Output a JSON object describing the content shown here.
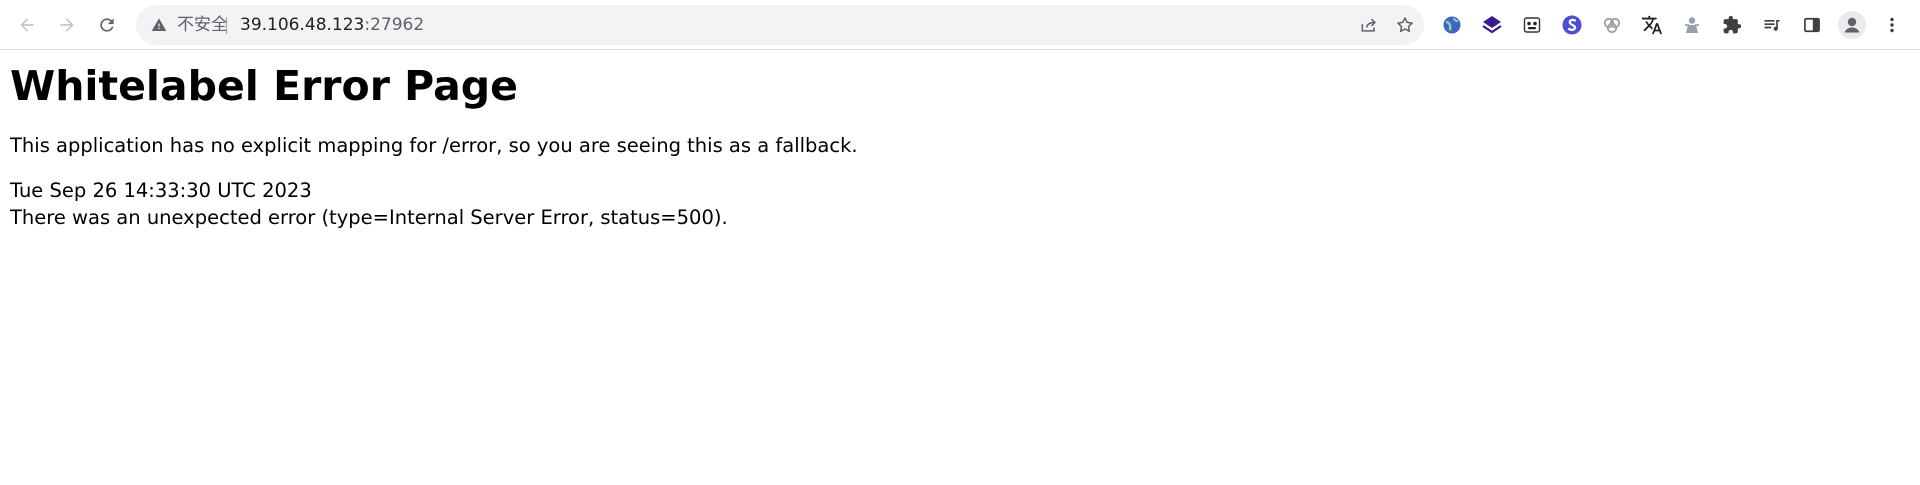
{
  "browser": {
    "security_label": "不安全",
    "url_host": "39.106.48.123",
    "url_port": ":27962",
    "icons": [
      "back-icon",
      "forward-icon",
      "reload-icon",
      "warning-icon",
      "share-icon",
      "star-icon",
      "puzzle-icon",
      "side-panel-icon",
      "profile-icon",
      "kebab-menu-icon"
    ]
  },
  "page": {
    "title": "Whitelabel Error Page",
    "message": "This application has no explicit mapping for /error, so you are seeing this as a fallback.",
    "timestamp": "Tue Sep 26 14:33:30 UTC 2023",
    "error_detail": "There was an unexpected error (type=Internal Server Error, status=500)."
  }
}
